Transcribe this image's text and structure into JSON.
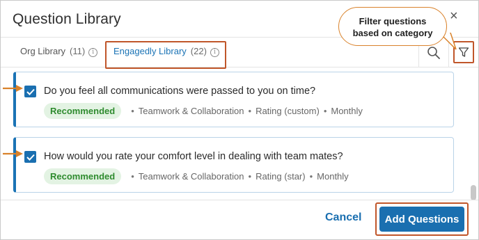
{
  "dialog": {
    "title": "Question Library",
    "close_label": "×"
  },
  "callout": {
    "line1": "Filter questions",
    "line2": "based on category"
  },
  "tabs": [
    {
      "label": "Org Library",
      "count": "(11)",
      "selected": false
    },
    {
      "label": "Engagedly Library",
      "count": "(22)",
      "selected": true
    }
  ],
  "questions": [
    {
      "text": "Do you feel all communications were passed to you on time?",
      "checked": true,
      "badge": "Recommended",
      "category": "Teamwork & Collaboration",
      "rating": "Rating (custom)",
      "frequency": "Monthly"
    },
    {
      "text": "How would you rate your comfort level in dealing with team mates?",
      "checked": true,
      "badge": "Recommended",
      "category": "Teamwork & Collaboration",
      "rating": "Rating (star)",
      "frequency": "Monthly"
    }
  ],
  "footer": {
    "cancel_label": "Cancel",
    "add_label": "Add Questions"
  },
  "colors": {
    "accent": "#1a6fb0",
    "highlight_border": "#c0562a",
    "badge_bg": "#e3f3e3",
    "badge_text": "#2e8b2e",
    "annotation_arrow": "#d9822b"
  },
  "icons": {
    "close": "close-icon",
    "info": "info-icon",
    "search": "search-icon",
    "filter": "filter-icon",
    "checkbox": "checkmark-icon"
  }
}
